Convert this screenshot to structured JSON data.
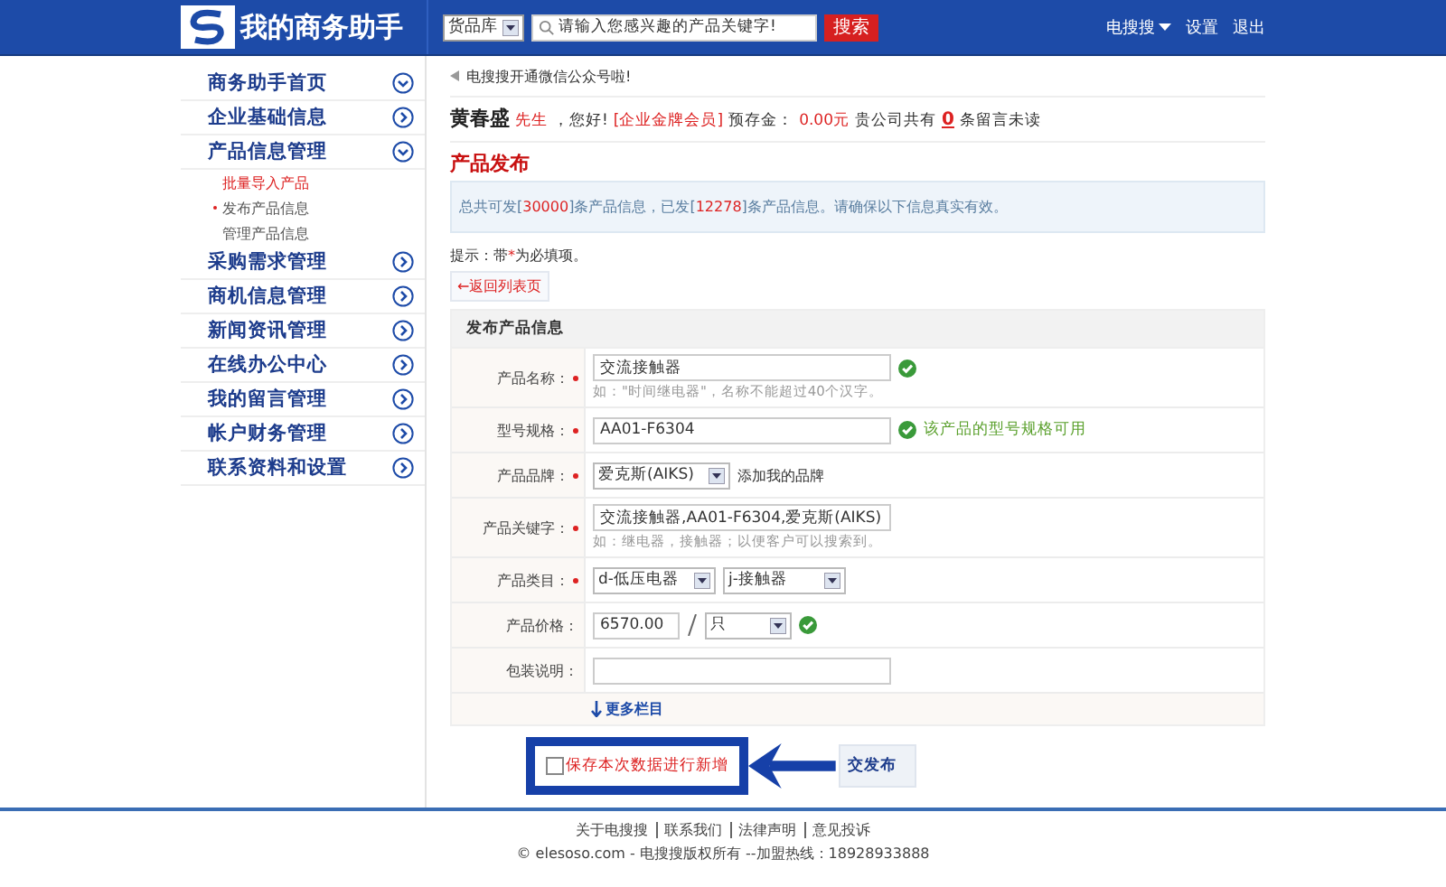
{
  "header": {
    "logo_text": "我的商务助手",
    "category_select": "货品库",
    "search": {
      "placeholder": "请输入您感兴趣的产品关键字!"
    },
    "search_button": "搜索",
    "nav": [
      {
        "label": "电搜搜",
        "dropdown": true
      },
      {
        "label": "设置",
        "dropdown": false
      },
      {
        "label": "退出",
        "dropdown": false
      }
    ]
  },
  "sidebar": {
    "items": [
      {
        "label": "商务助手首页",
        "expanded": true
      },
      {
        "label": "企业基础信息",
        "expanded": false
      },
      {
        "label": "产品信息管理",
        "expanded": true,
        "children": [
          {
            "label": "批量导入产品",
            "highlighted": true,
            "selected": false
          },
          {
            "label": "发布产品信息",
            "highlighted": false,
            "selected": true
          },
          {
            "label": "管理产品信息",
            "highlighted": false,
            "selected": false
          }
        ]
      },
      {
        "label": "采购需求管理",
        "expanded": false
      },
      {
        "label": "商机信息管理",
        "expanded": false
      },
      {
        "label": "新闻资讯管理",
        "expanded": false
      },
      {
        "label": "在线办公中心",
        "expanded": false
      },
      {
        "label": "我的留言管理",
        "expanded": false
      },
      {
        "label": "帐户财务管理",
        "expanded": false
      },
      {
        "label": "联系资料和设置",
        "expanded": false
      }
    ]
  },
  "notice": "电搜搜开通微信公众号啦!",
  "greeting": [
    {
      "kind": "name",
      "text": "黄春盛"
    },
    {
      "kind": "red",
      "text": "先生"
    },
    {
      "kind": "plain",
      "text": "，您好!"
    },
    {
      "kind": "red",
      "text": "[企业金牌会员]"
    },
    {
      "kind": "plain",
      "text": "预存金："
    },
    {
      "kind": "red",
      "text": "0.00元"
    },
    {
      "kind": "plain",
      "text": "贵公司共有"
    },
    {
      "kind": "count",
      "text": "0"
    },
    {
      "kind": "plain",
      "text": "条留言未读"
    }
  ],
  "section_title": "产品发布",
  "info": [
    {
      "kind": "plain",
      "text": "总共可发["
    },
    {
      "kind": "red",
      "text": "30000"
    },
    {
      "kind": "plain",
      "text": "]条产品信息，已发["
    },
    {
      "kind": "red",
      "text": "12278"
    },
    {
      "kind": "plain",
      "text": "]条产品信息。请确保以下信息真实有效。"
    }
  ],
  "hint": [
    {
      "kind": "plain",
      "text": "提示：带"
    },
    {
      "kind": "red",
      "text": "*"
    },
    {
      "kind": "plain",
      "text": "为必填项。"
    }
  ],
  "back_link": "←返回列表页",
  "form": {
    "title": "发布产品信息",
    "rows": [
      {
        "kind": "text",
        "label": "产品名称：",
        "required": true,
        "value": "交流接触器",
        "note": "如：\"时间继电器\"，名称不能超过40个汉字。",
        "valid": true
      },
      {
        "kind": "text",
        "label": "型号规格：",
        "required": true,
        "value": "AA01-F6304",
        "valid": true,
        "valid_text": "该产品的型号规格可用"
      },
      {
        "kind": "select",
        "label": "产品品牌：",
        "required": true,
        "value": "爱克斯(AIKS)",
        "link": "添加我的品牌",
        "valid": false
      },
      {
        "kind": "text",
        "label": "产品关键字：",
        "required": true,
        "value": "交流接触器,AA01-F6304,爱克斯(AIKS)",
        "note": "如：继电器，接触器；以便客户可以搜索到。",
        "valid": false
      },
      {
        "kind": "select2",
        "label": "产品类目：",
        "required": true,
        "value": "d-低压电器",
        "value2": "j-接触器",
        "valid": false
      },
      {
        "kind": "price",
        "label": "产品价格：",
        "required": false,
        "value": "6570.00",
        "unit": "只",
        "valid": true
      },
      {
        "kind": "text",
        "label": "包装说明：",
        "required": false,
        "value": "",
        "valid": false
      }
    ],
    "more_link": "更多栏目"
  },
  "save_checkbox": {
    "label": "保存本次数据进行新增",
    "checked": false
  },
  "submit_button": "交发布",
  "footer": {
    "links": [
      "关于电搜搜",
      "联系我们",
      "法律声明",
      "意见投诉"
    ],
    "copyright": "© elesoso.com - 电搜搜版权所有 --加盟热线：18928933888"
  }
}
